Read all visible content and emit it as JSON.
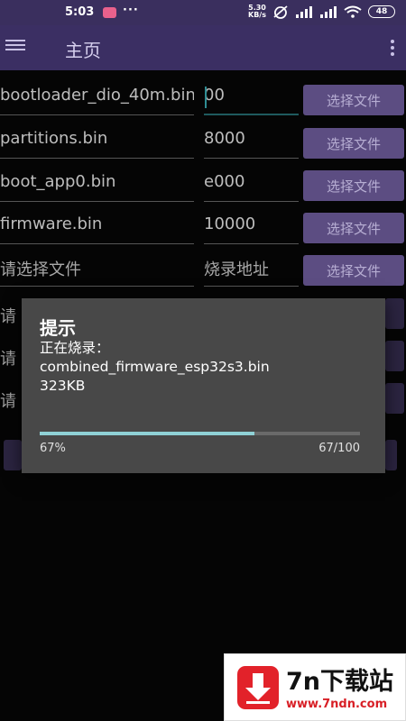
{
  "status_bar": {
    "time": "5:03",
    "dots": "···",
    "network_speed_value": "5.30",
    "network_speed_unit": "KB/s",
    "battery": "48"
  },
  "toolbar": {
    "title": "主页",
    "menu_icon": "hamburger-menu-icon",
    "more_icon": "more-vert-icon"
  },
  "rows": [
    {
      "file": "bootloader_dio_40m.bin",
      "address": "00",
      "button": "选择文件"
    },
    {
      "file": "partitions.bin",
      "address": "8000",
      "button": "选择文件"
    },
    {
      "file": "boot_app0.bin",
      "address": "e000",
      "button": "选择文件"
    },
    {
      "file": "firmware.bin",
      "address": "10000",
      "button": "选择文件"
    },
    {
      "file_placeholder": "请选择文件",
      "address_placeholder": "烧录地址",
      "button": "选择文件"
    }
  ],
  "obscured_rows_prefix": "请",
  "dialog": {
    "title": "提示",
    "line1": "正在烧录：",
    "line2": "combined_firmware_esp32s3.bin",
    "line3": "323KB",
    "progress": 0.67,
    "percent_text": "67%",
    "count_text": "67/100"
  },
  "watermark": {
    "brand": "7n下载站",
    "url": "www.7ndn.com"
  },
  "colors": {
    "toolbar": "#3b2f63",
    "button": "#5c4d82",
    "dialog": "#484848",
    "progress": "#8fd1d6",
    "watermark_red": "#e2222a"
  }
}
